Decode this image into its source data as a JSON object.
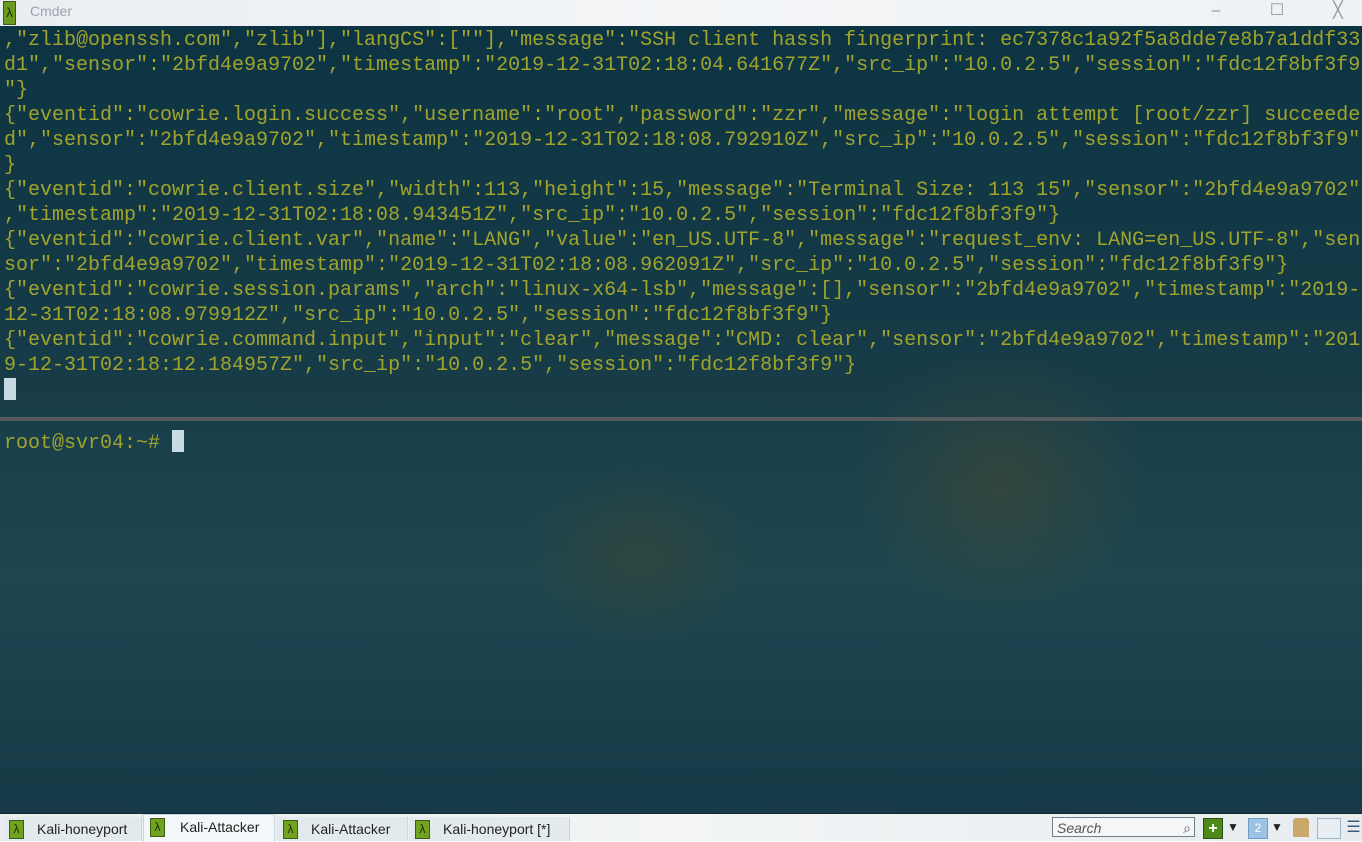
{
  "window": {
    "title": "Cmder",
    "minimize": "–",
    "maximize": "☐",
    "close": "╳"
  },
  "top_pane": {
    "lines": [
      ",\"zlib@openssh.com\",\"zlib\"],\"langCS\":[\"\"],\"message\":\"SSH client hassh fingerprint: ec7378c1a92f5a8dde7e8b7a1ddf33",
      "d1\",\"sensor\":\"2bfd4e9a9702\",\"timestamp\":\"2019-12-31T02:18:04.641677Z\",\"src_ip\":\"10.0.2.5\",\"session\":\"fdc12f8bf3f9",
      "\"}",
      "{\"eventid\":\"cowrie.login.success\",\"username\":\"root\",\"password\":\"zzr\",\"message\":\"login attempt [root/zzr] succeede",
      "d\",\"sensor\":\"2bfd4e9a9702\",\"timestamp\":\"2019-12-31T02:18:08.792910Z\",\"src_ip\":\"10.0.2.5\",\"session\":\"fdc12f8bf3f9\"",
      "}",
      "{\"eventid\":\"cowrie.client.size\",\"width\":113,\"height\":15,\"message\":\"Terminal Size: 113 15\",\"sensor\":\"2bfd4e9a9702\"",
      ",\"timestamp\":\"2019-12-31T02:18:08.943451Z\",\"src_ip\":\"10.0.2.5\",\"session\":\"fdc12f8bf3f9\"}",
      "{\"eventid\":\"cowrie.client.var\",\"name\":\"LANG\",\"value\":\"en_US.UTF-8\",\"message\":\"request_env: LANG=en_US.UTF-8\",\"sen",
      "sor\":\"2bfd4e9a9702\",\"timestamp\":\"2019-12-31T02:18:08.962091Z\",\"src_ip\":\"10.0.2.5\",\"session\":\"fdc12f8bf3f9\"}",
      "{\"eventid\":\"cowrie.session.params\",\"arch\":\"linux-x64-lsb\",\"message\":[],\"sensor\":\"2bfd4e9a9702\",\"timestamp\":\"2019-",
      "12-31T02:18:08.979912Z\",\"src_ip\":\"10.0.2.5\",\"session\":\"fdc12f8bf3f9\"}",
      "{\"eventid\":\"cowrie.command.input\",\"input\":\"clear\",\"message\":\"CMD: clear\",\"sensor\":\"2bfd4e9a9702\",\"timestamp\":\"201",
      "9-12-31T02:18:12.184957Z\",\"src_ip\":\"10.0.2.5\",\"session\":\"fdc12f8bf3f9\"}"
    ]
  },
  "bottom_pane": {
    "prompt": "root@svr04:~# "
  },
  "tabs": [
    {
      "label": "Kali-honeyport",
      "active": false
    },
    {
      "label": "Kali-Attacker",
      "active": true
    },
    {
      "label": "Kali-Attacker",
      "active": false
    },
    {
      "label": "Kali-honeyport [*]",
      "active": false
    }
  ],
  "toolbar": {
    "search_placeholder": "Search",
    "console_number": "2"
  },
  "colors": {
    "terminal_text": "#a0a42c",
    "terminal_bg": "#0d3443",
    "cursor": "#c6dbe3",
    "app_icon": "#72a320"
  }
}
